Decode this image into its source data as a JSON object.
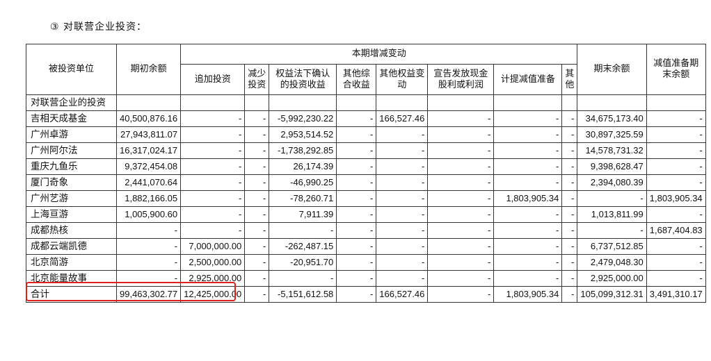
{
  "title": "③ 对联营企业投资：",
  "headers": {
    "investee": "被投资单位",
    "opening": "期初余额",
    "changes_group": "本期增减变动",
    "add_invest": "追加投资",
    "reduce_invest": "减少投资",
    "equity_income": "权益法下确认的投资收益",
    "other_ci": "其他综合收益",
    "other_equity": "其他权益变动",
    "dividends": "宣告发放现金股利或利润",
    "impairment": "计提减值准备",
    "other": "其他",
    "closing": "期末余额",
    "impairment_closing": "减值准备期末余额"
  },
  "section_label": "对联营企业的投资",
  "rows": [
    {
      "name": "吉相天成基金",
      "opening": "40,500,876.16",
      "add": "-",
      "reduce": "-",
      "equity_income": "-5,992,230.22",
      "other_ci": "-",
      "other_equity": "166,527.46",
      "dividends": "-",
      "impairment": "-",
      "other": "-",
      "closing": "34,675,173.40",
      "impairment_closing": "-"
    },
    {
      "name": "广州卓游",
      "opening": "27,943,811.07",
      "add": "-",
      "reduce": "-",
      "equity_income": "2,953,514.52",
      "other_ci": "-",
      "other_equity": "-",
      "dividends": "-",
      "impairment": "-",
      "other": "-",
      "closing": "30,897,325.59",
      "impairment_closing": "-"
    },
    {
      "name": "广州阿尔法",
      "opening": "16,317,024.17",
      "add": "-",
      "reduce": "-",
      "equity_income": "-1,738,292.85",
      "other_ci": "-",
      "other_equity": "-",
      "dividends": "-",
      "impairment": "-",
      "other": "-",
      "closing": "14,578,731.32",
      "impairment_closing": "-"
    },
    {
      "name": "重庆九鱼乐",
      "opening": "9,372,454.08",
      "add": "-",
      "reduce": "-",
      "equity_income": "26,174.39",
      "other_ci": "-",
      "other_equity": "-",
      "dividends": "-",
      "impairment": "-",
      "other": "-",
      "closing": "9,398,628.47",
      "impairment_closing": "-"
    },
    {
      "name": "厦门奇象",
      "opening": "2,441,070.64",
      "add": "-",
      "reduce": "-",
      "equity_income": "-46,990.25",
      "other_ci": "-",
      "other_equity": "-",
      "dividends": "-",
      "impairment": "-",
      "other": "-",
      "closing": "2,394,080.39",
      "impairment_closing": "-"
    },
    {
      "name": "广州艺游",
      "opening": "1,882,166.05",
      "add": "-",
      "reduce": "-",
      "equity_income": "-78,260.71",
      "other_ci": "-",
      "other_equity": "-",
      "dividends": "-",
      "impairment": "1,803,905.34",
      "other": "-",
      "closing": "-",
      "impairment_closing": "1,803,905.34"
    },
    {
      "name": "上海亘游",
      "opening": "1,005,900.60",
      "add": "-",
      "reduce": "-",
      "equity_income": "7,911.39",
      "other_ci": "-",
      "other_equity": "-",
      "dividends": "-",
      "impairment": "-",
      "other": "-",
      "closing": "1,013,811.99",
      "impairment_closing": "-"
    },
    {
      "name": "成都热核",
      "opening": "-",
      "add": "-",
      "reduce": "-",
      "equity_income": "-",
      "other_ci": "-",
      "other_equity": "-",
      "dividends": "-",
      "impairment": "-",
      "other": "-",
      "closing": "-",
      "impairment_closing": "1,687,404.83"
    },
    {
      "name": "成都云端凯德",
      "opening": "-",
      "add": "7,000,000.00",
      "reduce": "-",
      "equity_income": "-262,487.15",
      "other_ci": "-",
      "other_equity": "-",
      "dividends": "-",
      "impairment": "-",
      "other": "-",
      "closing": "6,737,512.85",
      "impairment_closing": "-"
    },
    {
      "name": "北京简游",
      "opening": "-",
      "add": "2,500,000.00",
      "reduce": "-",
      "equity_income": "-20,951.70",
      "other_ci": "-",
      "other_equity": "-",
      "dividends": "-",
      "impairment": "-",
      "other": "-",
      "closing": "2,479,048.30",
      "impairment_closing": "-"
    },
    {
      "name": "北京能量故事",
      "opening": "-",
      "add": "2,925,000.00",
      "reduce": "-",
      "equity_income": "-",
      "other_ci": "-",
      "other_equity": "-",
      "dividends": "-",
      "impairment": "-",
      "other": "-",
      "closing": "2,925,000.00",
      "impairment_closing": "-"
    }
  ],
  "total": {
    "name": "合计",
    "opening": "99,463,302.77",
    "add": "12,425,000.00",
    "reduce": "-",
    "equity_income": "-5,151,612.58",
    "other_ci": "-",
    "other_equity": "166,527.46",
    "dividends": "-",
    "impairment": "1,803,905.34",
    "other": "-",
    "closing": "105,099,312.31",
    "impairment_closing": "3,491,310.17"
  },
  "highlight_color": "#e0201a"
}
